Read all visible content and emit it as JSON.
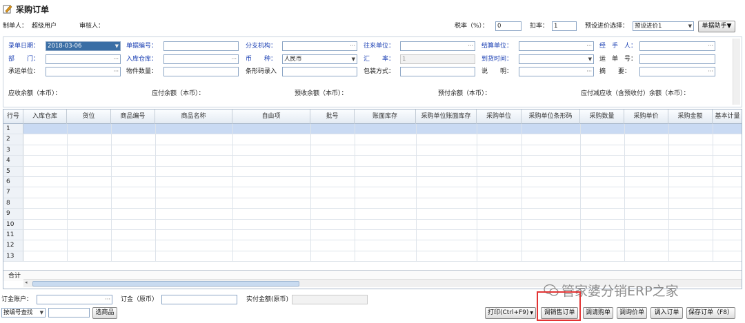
{
  "title": "采购订单",
  "header": {
    "creator_label": "制单人：",
    "creator_value": "超级用户",
    "auditor_label": "审核人：",
    "tax_label": "税率（%）：",
    "tax_value": "0",
    "discount_label": "扣率：",
    "discount_value": "1",
    "preset_label": "预设进价选择：",
    "preset_value": "预设进价1",
    "helper_button": "单据助手▼"
  },
  "form": {
    "date_label": "录单日期：",
    "date_value": "2018-03-06",
    "billno_label": "单据编号：",
    "branch_label": "分支机构：",
    "partner_label": "往来单位：",
    "settle_label": "结算单位：",
    "handler_label": "经　手　人：",
    "dept_label": "部　　门：",
    "warehouse_label": "入库仓库：",
    "currency_label": "币　　种：",
    "currency_value": "人民币",
    "rate_label": "汇　　率：",
    "rate_value": "1",
    "arrival_label": "到货时间：",
    "waybill_label": "运　单　号：",
    "carrier_label": "承运单位：",
    "pieces_label": "物件数量：",
    "barcode_label": "条形码录入",
    "packing_label": "包装方式：",
    "note_label": "说　　明：",
    "summary_label": "摘　　要：",
    "recv_bal_label": "应收余额（本币）：",
    "pay_bal_label": "应付余额（本币）：",
    "prerecv_label": "预收余额（本币）：",
    "prepay_label": "预付余额（本币）：",
    "net_label": "应付减应收（含预收付）余额（本币）："
  },
  "grid": {
    "columns": [
      "行号",
      "入库仓库",
      "货位",
      "商品编号",
      "商品名称",
      "自由项",
      "批号",
      "账面库存",
      "采购单位账面库存",
      "采购单位",
      "采购单位条形码",
      "采购数量",
      "采购单价",
      "采购金额",
      "基本计量"
    ],
    "rows": [
      "1",
      "2",
      "3",
      "4",
      "5",
      "6",
      "7",
      "8",
      "9",
      "10",
      "11",
      "12",
      "13"
    ],
    "total_label": "合计"
  },
  "footer": {
    "deposit_account_label": "订金账户：",
    "deposit_label": "订金（原币）",
    "actual_label": "实付金额(原币)",
    "search_mode": "按编号查找",
    "pick_goods": "选商品",
    "print": "打印(Ctrl+F9)",
    "sales_order": "调销售订单",
    "purchase_order": "调请购单",
    "price_order": "调询价单",
    "import_order": "调入订单",
    "save": "保存订单（F8）"
  },
  "watermark": "管家婆分销ERP之家"
}
